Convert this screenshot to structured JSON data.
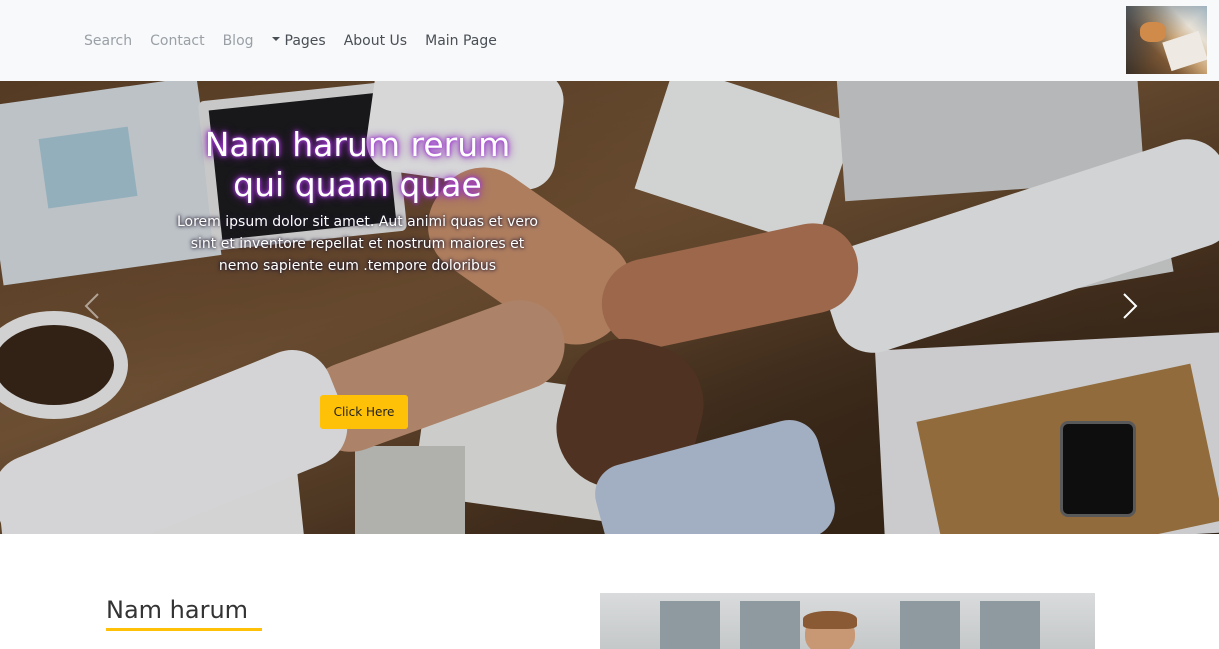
{
  "navbar": {
    "links": [
      "Search",
      "Contact",
      "Blog"
    ],
    "pages_label": "Pages",
    "about_label": "About Us",
    "main_label": "Main Page"
  },
  "hero": {
    "title": "Nam harum rerum qui quam quae",
    "text": "Lorem ipsum dolor sit amet. Aut animi quas et vero sint et inventore repellat et nostrum maiores et nemo sapiente eum .tempore doloribus",
    "button_label": "Click Here",
    "button_color": "#ffc107",
    "title_glow_color": "#a23bd6"
  },
  "section": {
    "title": "Nam harum",
    "accent_color": "#ffc107"
  },
  "icons": {
    "prev": "chevron-left-icon",
    "next": "chevron-right-icon",
    "caret": "caret-down-icon"
  }
}
